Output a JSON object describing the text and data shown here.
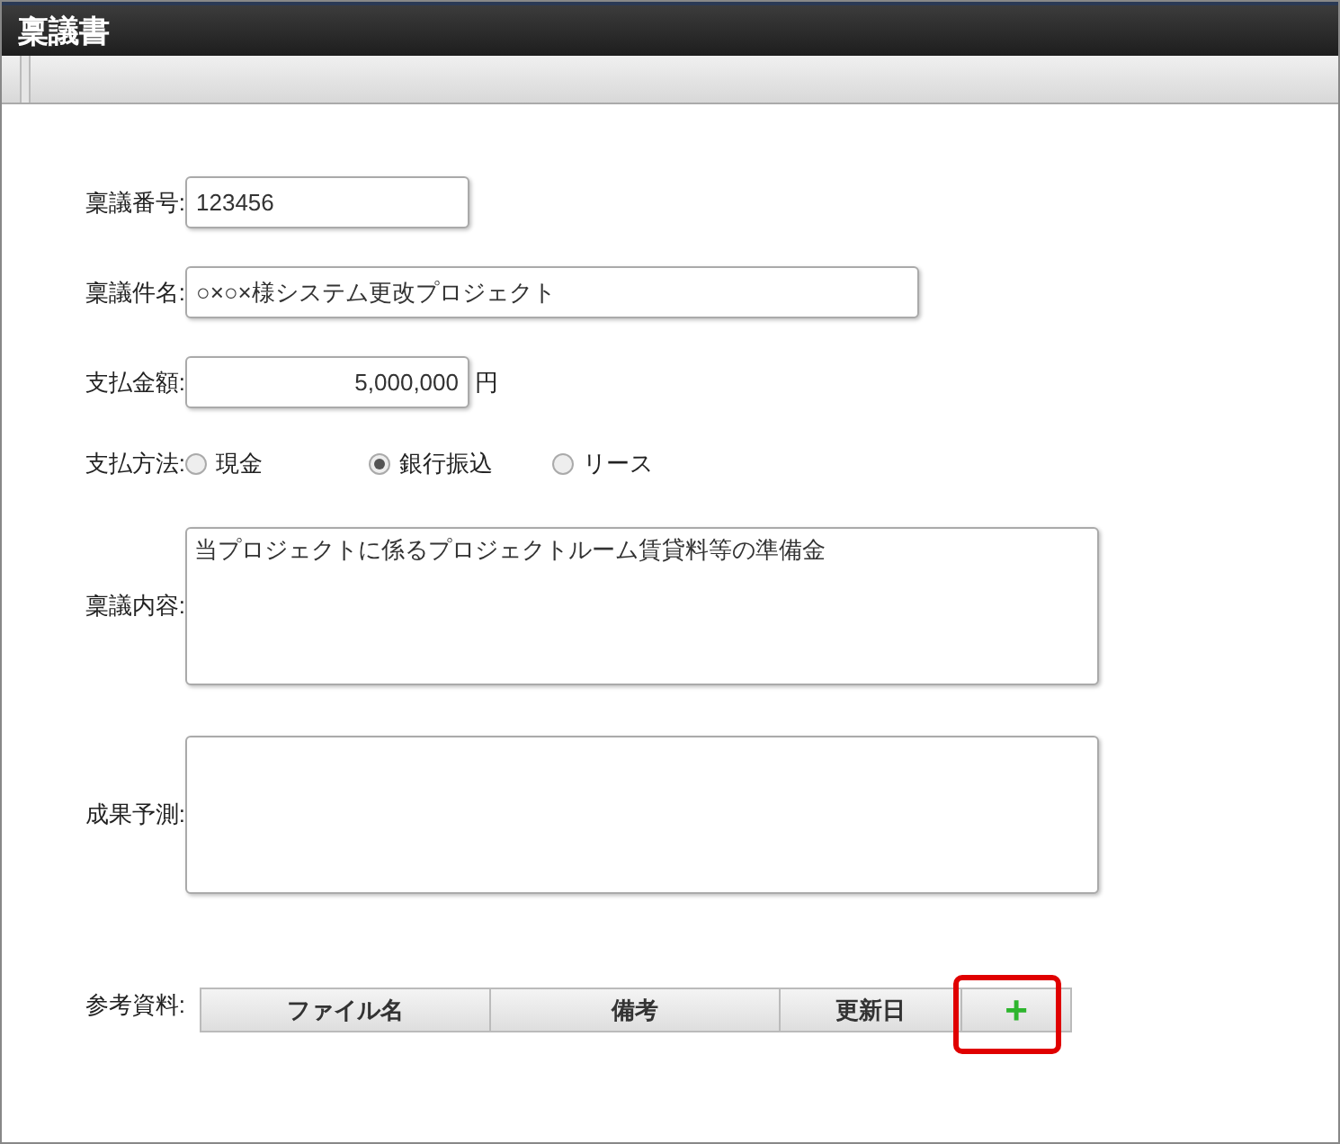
{
  "window": {
    "title": "稟議書"
  },
  "fields": [
    {
      "kind": "text",
      "label": "稟議番号:",
      "value": "123456"
    },
    {
      "kind": "wide",
      "label": "稟議件名:",
      "value": "○×○×様システム更改プロジェクト"
    },
    {
      "kind": "amount",
      "label": "支払金額:",
      "value": "5,000,000",
      "unit": "円"
    },
    {
      "kind": "radio",
      "label": "支払方法:",
      "options": [
        {
          "label": "現金",
          "selected": false
        },
        {
          "label": "銀行振込",
          "selected": true
        },
        {
          "label": "リース",
          "selected": false
        }
      ]
    },
    {
      "kind": "textarea",
      "label": "稟議内容:",
      "value": "当プロジェクトに係るプロジェクトルーム賃貸料等の準備金"
    },
    {
      "kind": "textarea",
      "label": "成果予測:"
    },
    {
      "kind": "table",
      "label": "参考資料:",
      "columns": [
        "ファイル名",
        "備考",
        "更新日"
      ],
      "add_button": {
        "label": "+",
        "highlighted": true
      }
    }
  ]
}
